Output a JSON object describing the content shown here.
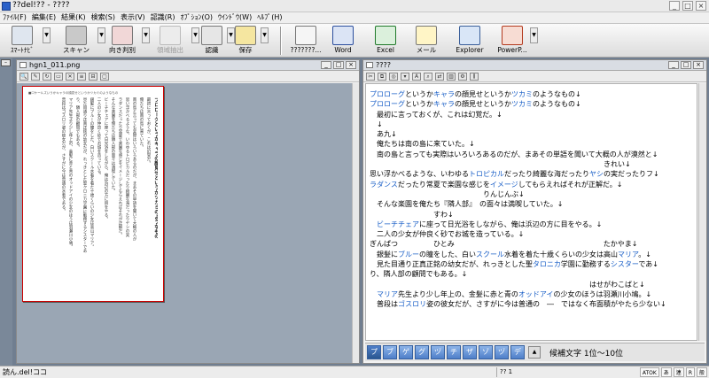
{
  "app": {
    "title": "??del!?? - ????",
    "window_buttons": [
      "_",
      "□",
      "×"
    ]
  },
  "menu": [
    "ﾌｧｲﾙ(F)",
    "編集(E)",
    "結果(K)",
    "検索(S)",
    "表示(V)",
    "認識(R)",
    "ｵﾌﾟｼｮﾝ(O)",
    "ｳｲﾝﾄﾞｳ(W)",
    "ﾍﾙﾌﾟ(H)"
  ],
  "toolbar": {
    "smart_navi": "ｽﾏｰﾄﾅﾋﾞ",
    "scan": "スキャン",
    "orientation": "向き判別",
    "region": "領域抽出",
    "recognize": "認識",
    "save": "保存",
    "send_unknown": "???????...",
    "word": "Word",
    "excel": "Excel",
    "mail": "メール",
    "explorer": "Explorer",
    "powerpoint": "PowerP...",
    "dropdown_glyph": "▼"
  },
  "colors": {
    "accent": "#1a5fc7",
    "page_border": "#cc0000"
  },
  "left_window": {
    "title": "hgn1_011.png",
    "page_header": "■ロケールズいうかキャラの顔見せというかツカミのようなもの",
    "vertical_columns": [
      "プロローグというかキャラの顔見せというかツカミのようなもの",
      "最初に言っておくが、これは幻覚だ。",
      "俺たちは南の島に来ていた。",
      "南の島と言っても実際はいろいろあるのだが、まあその単語を聞いて大概の人が",
      "思い浮かべるような、いわゆるトロピカルだったり綺麗な海だったりヤシの実",
      "ラダンスだったり常夏で楽園な感じをイメージしてもらえればそれが正解だ。",
      "そんな楽園を俺たちは隣人部の面々は満喫していた。",
      "ビーチチェアに座って日光浴をしながら、俺は浜辺の方に目をやる。",
      "二人の少女が仲良く砂でお城を造っている。",
      "銀髪にブルーの瞳をした、白いスクール水着を着た十歳くらいの少女は高山マリア。",
      "見た目通り正真正銘の幼女だが、れっきとした聖クロニカ学園に勤務するシスターであ",
      "り、隣人部の顧問でもある。",
      "マリア先生より少し年上の、金髪に赤と青のオッドアイの少女のほうは羽瀬川小鳩。",
      "普段はゴスロリ姿の彼女だが、さすがに今は普通の水着である。"
    ]
  },
  "right_window": {
    "title": "????",
    "lines": [
      [
        "",
        [
          "m",
          "プロローグ"
        ],
        "というか",
        [
          "m",
          "キャラ"
        ],
        "の顔見せというか",
        [
          "m",
          "ツカミ"
        ],
        "のようなもの↓"
      ],
      [
        [
          "m",
          "プロローグ"
        ],
        "というか",
        [
          "m",
          "キャラ"
        ],
        "の顔見せというか",
        [
          "m",
          "ツカミ"
        ],
        "のようなもの↓"
      ],
      [
        "　最初に言っておくが、これは幻覚だ。↓"
      ],
      [
        "　↓"
      ],
      [
        "　あ九↓"
      ],
      [
        "　俺たちは南の島に来ていた。↓"
      ],
      [
        "　南の島と言っても実際はいろいろあるのだが、まあその単語を聞いて大概の人が漠然と↓"
      ],
      [
        "　　　　　　　　　　　　　　　　　　　　　　　　　　　　　　　　　きれい↓"
      ],
      [
        "思い浮かべるような、いわゆる",
        [
          "m",
          "トロピカル"
        ],
        "だったり綺麗な海だったり",
        [
          "m",
          "ヤシ"
        ],
        "の実だったりフ↓"
      ],
      [
        [
          "m",
          "ラダンス"
        ],
        "だったり常夏で楽園な感じを",
        [
          "m",
          "イメージ"
        ],
        "してもらえればそれが正解だ。↓"
      ],
      [
        "　　　　　　　　　　　　　　　　りんじんぶ↓"
      ],
      [
        "　そんな楽園を俺たち『隣人部』　の面々は満喫していた。↓"
      ],
      [
        "　　　　　　　　　すわ↓"
      ],
      [
        "　",
        [
          "m",
          "ビーチチェア"
        ],
        "に座って日光浴をしながら、俺は浜辺の方に目をやる。↓"
      ],
      [
        "　二人の少女が仲良く砂でお城を造っている。↓"
      ],
      [
        "ぎんぱつ　　　　　ひとみ　　　　　　　　　　　　　　　　　　　　　たかやま↓"
      ],
      [
        "　銀髪に",
        [
          "m",
          "ブルー"
        ],
        "の瞳をした、白い",
        [
          "m",
          "スクール"
        ],
        "水着を着た十歳くらいの少女は高山",
        [
          "m",
          "マリア"
        ],
        "。↓"
      ],
      [
        "　見た目通り正真正銘の幼女だが、れっきとした聖",
        [
          "m",
          "タロニカ"
        ],
        "学園に勤務する",
        [
          "m",
          "シスター"
        ],
        "であ↓"
      ],
      [
        "り、隣人部の顧問でもある。↓"
      ],
      [
        "　　　　　　　　　　　　　　　　　　　　　　　　　　　　　　　はせがわこばと↓"
      ],
      [
        "　",
        [
          "m",
          "マリア"
        ],
        "先生より少し年上の、金髪に赤と青の",
        [
          "m",
          "オッドアイ"
        ],
        "の少女のほうは羽瀬川小鳩。↓"
      ],
      [
        "　普段は",
        [
          "m",
          "ゴスロリ"
        ],
        "姿の彼女だが、さすがに今は普通の　―　ではなく布面積がやたら少ない↓"
      ]
    ],
    "kana_buttons": [
      "プ",
      "ブ",
      "ゲ",
      "グ",
      "ヅ",
      "チ",
      "ザ",
      "ゾ",
      "ヅ",
      "デ"
    ],
    "candidate_label": "候補文字 1位〜10位"
  },
  "status": {
    "left": "読ん.del!ココ",
    "mid": "?? 1",
    "ime": [
      "ATOK",
      "あ",
      "連",
      "R",
      "般"
    ]
  }
}
